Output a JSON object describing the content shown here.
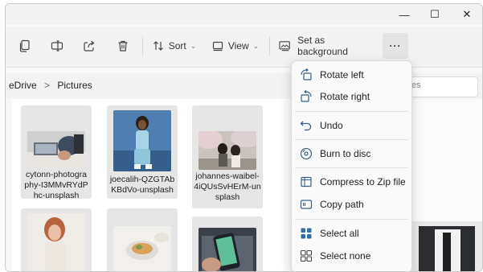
{
  "window": {
    "controls": {
      "minimize": "—",
      "maximize": "☐",
      "close": "✕"
    }
  },
  "toolbar": {
    "sort_label": "Sort",
    "view_label": "View",
    "set_background_label": "Set as background",
    "more_label": "···",
    "icons": [
      "copy-icon",
      "rename-icon",
      "share-icon",
      "delete-icon",
      "sort-icon",
      "view-icon",
      "wallpaper-icon"
    ]
  },
  "address": {
    "path_part1": "eDrive",
    "separator": ">",
    "path_part2": "Pictures",
    "search_placeholder": "es"
  },
  "files": [
    {
      "name": "cytonn-photography-I3MMvRYdPhc-unsplash",
      "line1": "cytonn-photogra",
      "line2": "phy-I3MMvRYdP",
      "line3": "hc-unsplash"
    },
    {
      "name": "joecalih-QZGTAbKBdVo-unsplash",
      "line1": "joecalih-QZGTAb",
      "line2": "KBdVo-unsplash"
    },
    {
      "name": "johannes-waibel-4iQUsSvHErM-unsplash",
      "line1": "johannes-waibel-",
      "line2": "4iQUsSvHErM-un",
      "line3": "splash"
    }
  ],
  "context_menu": {
    "items": [
      {
        "label": "Rotate left",
        "icon": "rotate-left-icon"
      },
      {
        "label": "Rotate right",
        "icon": "rotate-right-icon"
      },
      {
        "label": "Undo",
        "icon": "undo-icon"
      },
      {
        "label": "Burn to disc",
        "icon": "disc-icon"
      },
      {
        "label": "Compress to Zip file",
        "icon": "zip-icon"
      },
      {
        "label": "Copy path",
        "icon": "copy-path-icon"
      },
      {
        "label": "Select all",
        "icon": "select-all-icon"
      },
      {
        "label": "Select none",
        "icon": "select-none-icon"
      }
    ]
  },
  "colors": {
    "accent": "#2f6fb0",
    "menu_bg": "#fafafa",
    "tile_bg": "#e6e6e6"
  }
}
